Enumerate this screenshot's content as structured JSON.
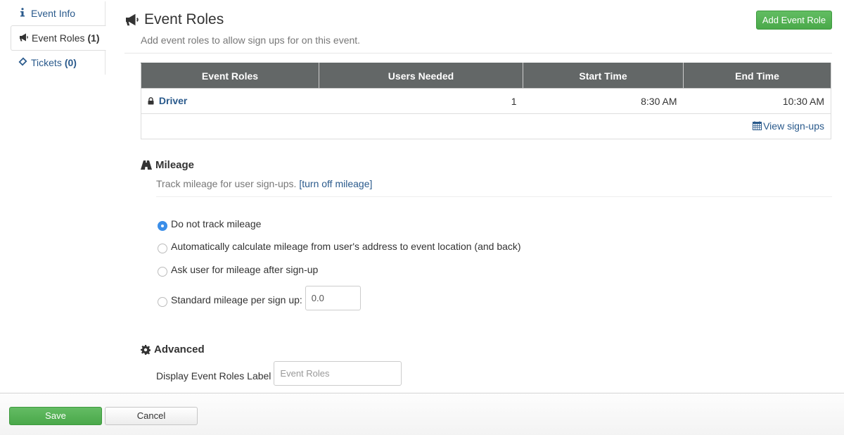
{
  "sidebar": {
    "items": [
      {
        "icon": "info-icon",
        "label": "Event Info",
        "count": ""
      },
      {
        "icon": "bullhorn-icon",
        "label": "Event Roles",
        "count": "(1)"
      },
      {
        "icon": "ticket-icon",
        "label": "Tickets",
        "count": "(0)"
      }
    ]
  },
  "header": {
    "title": "Event Roles",
    "subtitle": "Add event roles to allow sign ups for on this event.",
    "add_button": "Add Event Role"
  },
  "table": {
    "columns": [
      "Event Roles",
      "Users Needed",
      "Start Time",
      "End Time"
    ],
    "rows": [
      {
        "role": "Driver",
        "locked": true,
        "users_needed": "1",
        "start_time": "8:30 AM",
        "end_time": "10:30 AM"
      }
    ],
    "view_signups": "View sign-ups"
  },
  "mileage": {
    "title": "Mileage",
    "description": "Track mileage for user sign-ups.",
    "toggle_link": "[turn off mileage]",
    "options": [
      {
        "label": "Do not track mileage",
        "checked": true
      },
      {
        "label": "Automatically calculate mileage from user's address to event location (and back)",
        "checked": false
      },
      {
        "label": "Ask user for mileage after sign-up",
        "checked": false
      },
      {
        "label": "Standard mileage per sign up:",
        "checked": false
      }
    ],
    "standard_mileage_value": "0.0"
  },
  "advanced": {
    "title": "Advanced",
    "display_label": "Display Event Roles Label",
    "display_placeholder": "Event Roles",
    "display_value": ""
  },
  "footer": {
    "save": "Save",
    "cancel": "Cancel"
  },
  "colors": {
    "primary_green": "#4cae4c",
    "link_blue": "#2a5a8c",
    "table_header": "#636767",
    "radio_checked": "#3b8ee8"
  }
}
